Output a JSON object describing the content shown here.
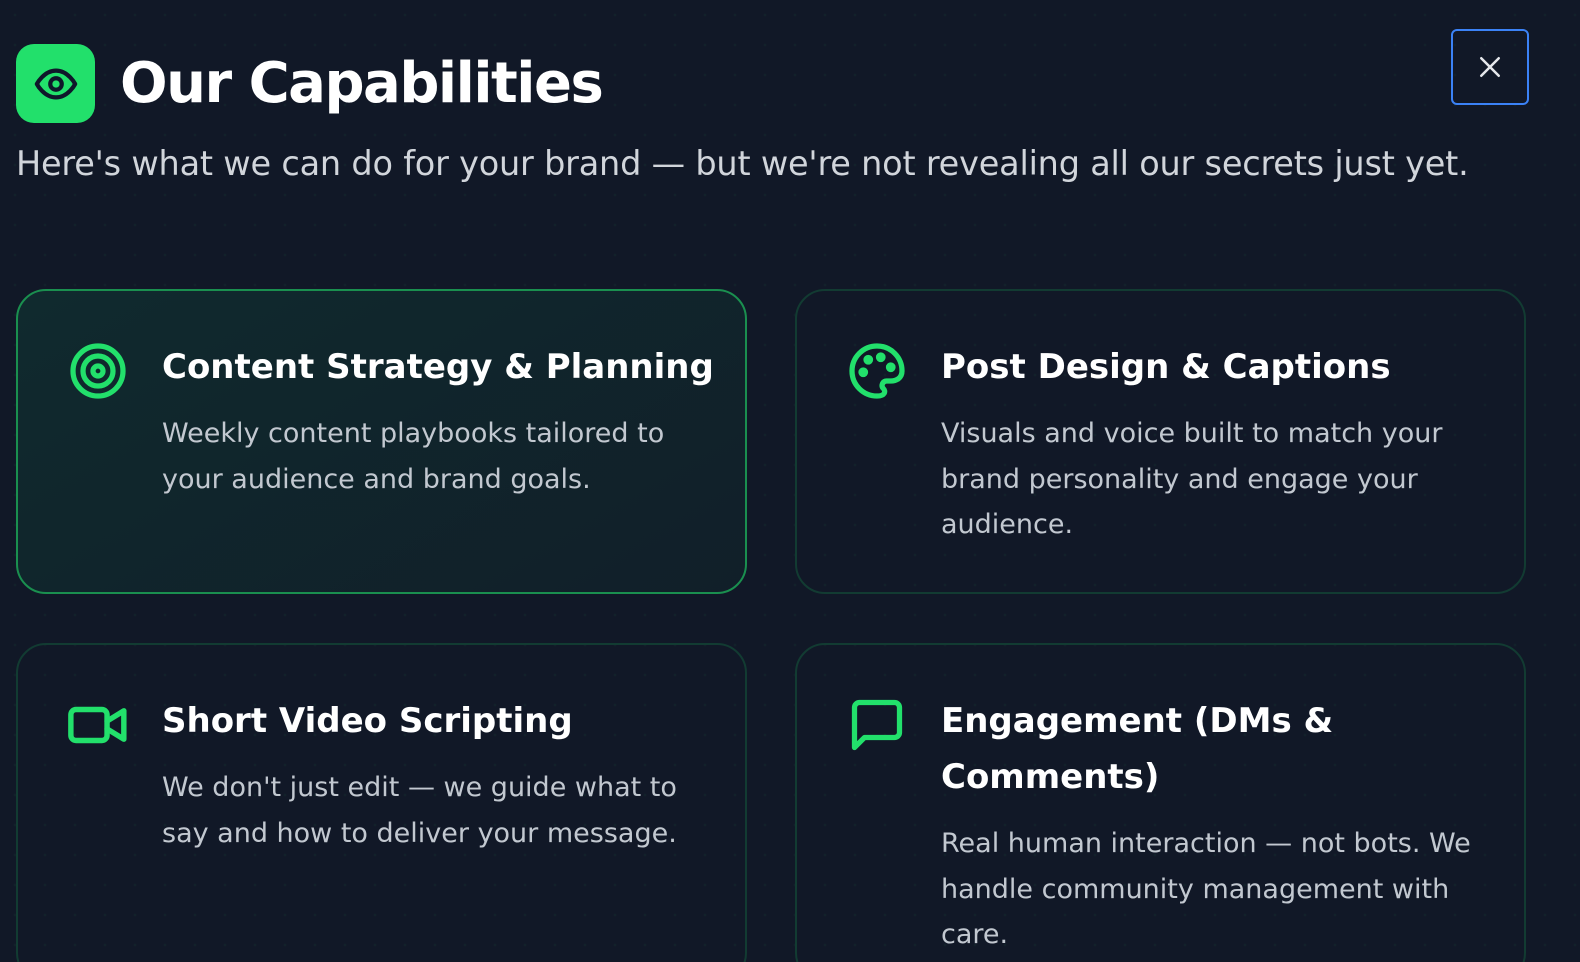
{
  "header": {
    "title": "Our Capabilities",
    "subtitle": "Here's what we can do for your brand — but we're not revealing all our secrets just yet.",
    "icon": "eye-icon",
    "close_icon": "close-icon"
  },
  "colors": {
    "accent": "#22e06b",
    "background": "#111827",
    "focus_ring": "#3b82f6"
  },
  "cards": [
    {
      "title": "Content Strategy & Planning",
      "description": "Weekly content playbooks tailored to your audience and brand goals.",
      "icon": "target-icon"
    },
    {
      "title": "Post Design & Captions",
      "description": "Visuals and voice built to match your brand personality and engage your audience.",
      "icon": "palette-icon"
    },
    {
      "title": "Short Video Scripting",
      "description": "We don't just edit — we guide what to say and how to deliver your message.",
      "icon": "video-camera-icon"
    },
    {
      "title": "Engagement (DMs & Comments)",
      "description": "Real human interaction — not bots. We handle community management with care.",
      "icon": "chat-bubble-icon"
    }
  ]
}
